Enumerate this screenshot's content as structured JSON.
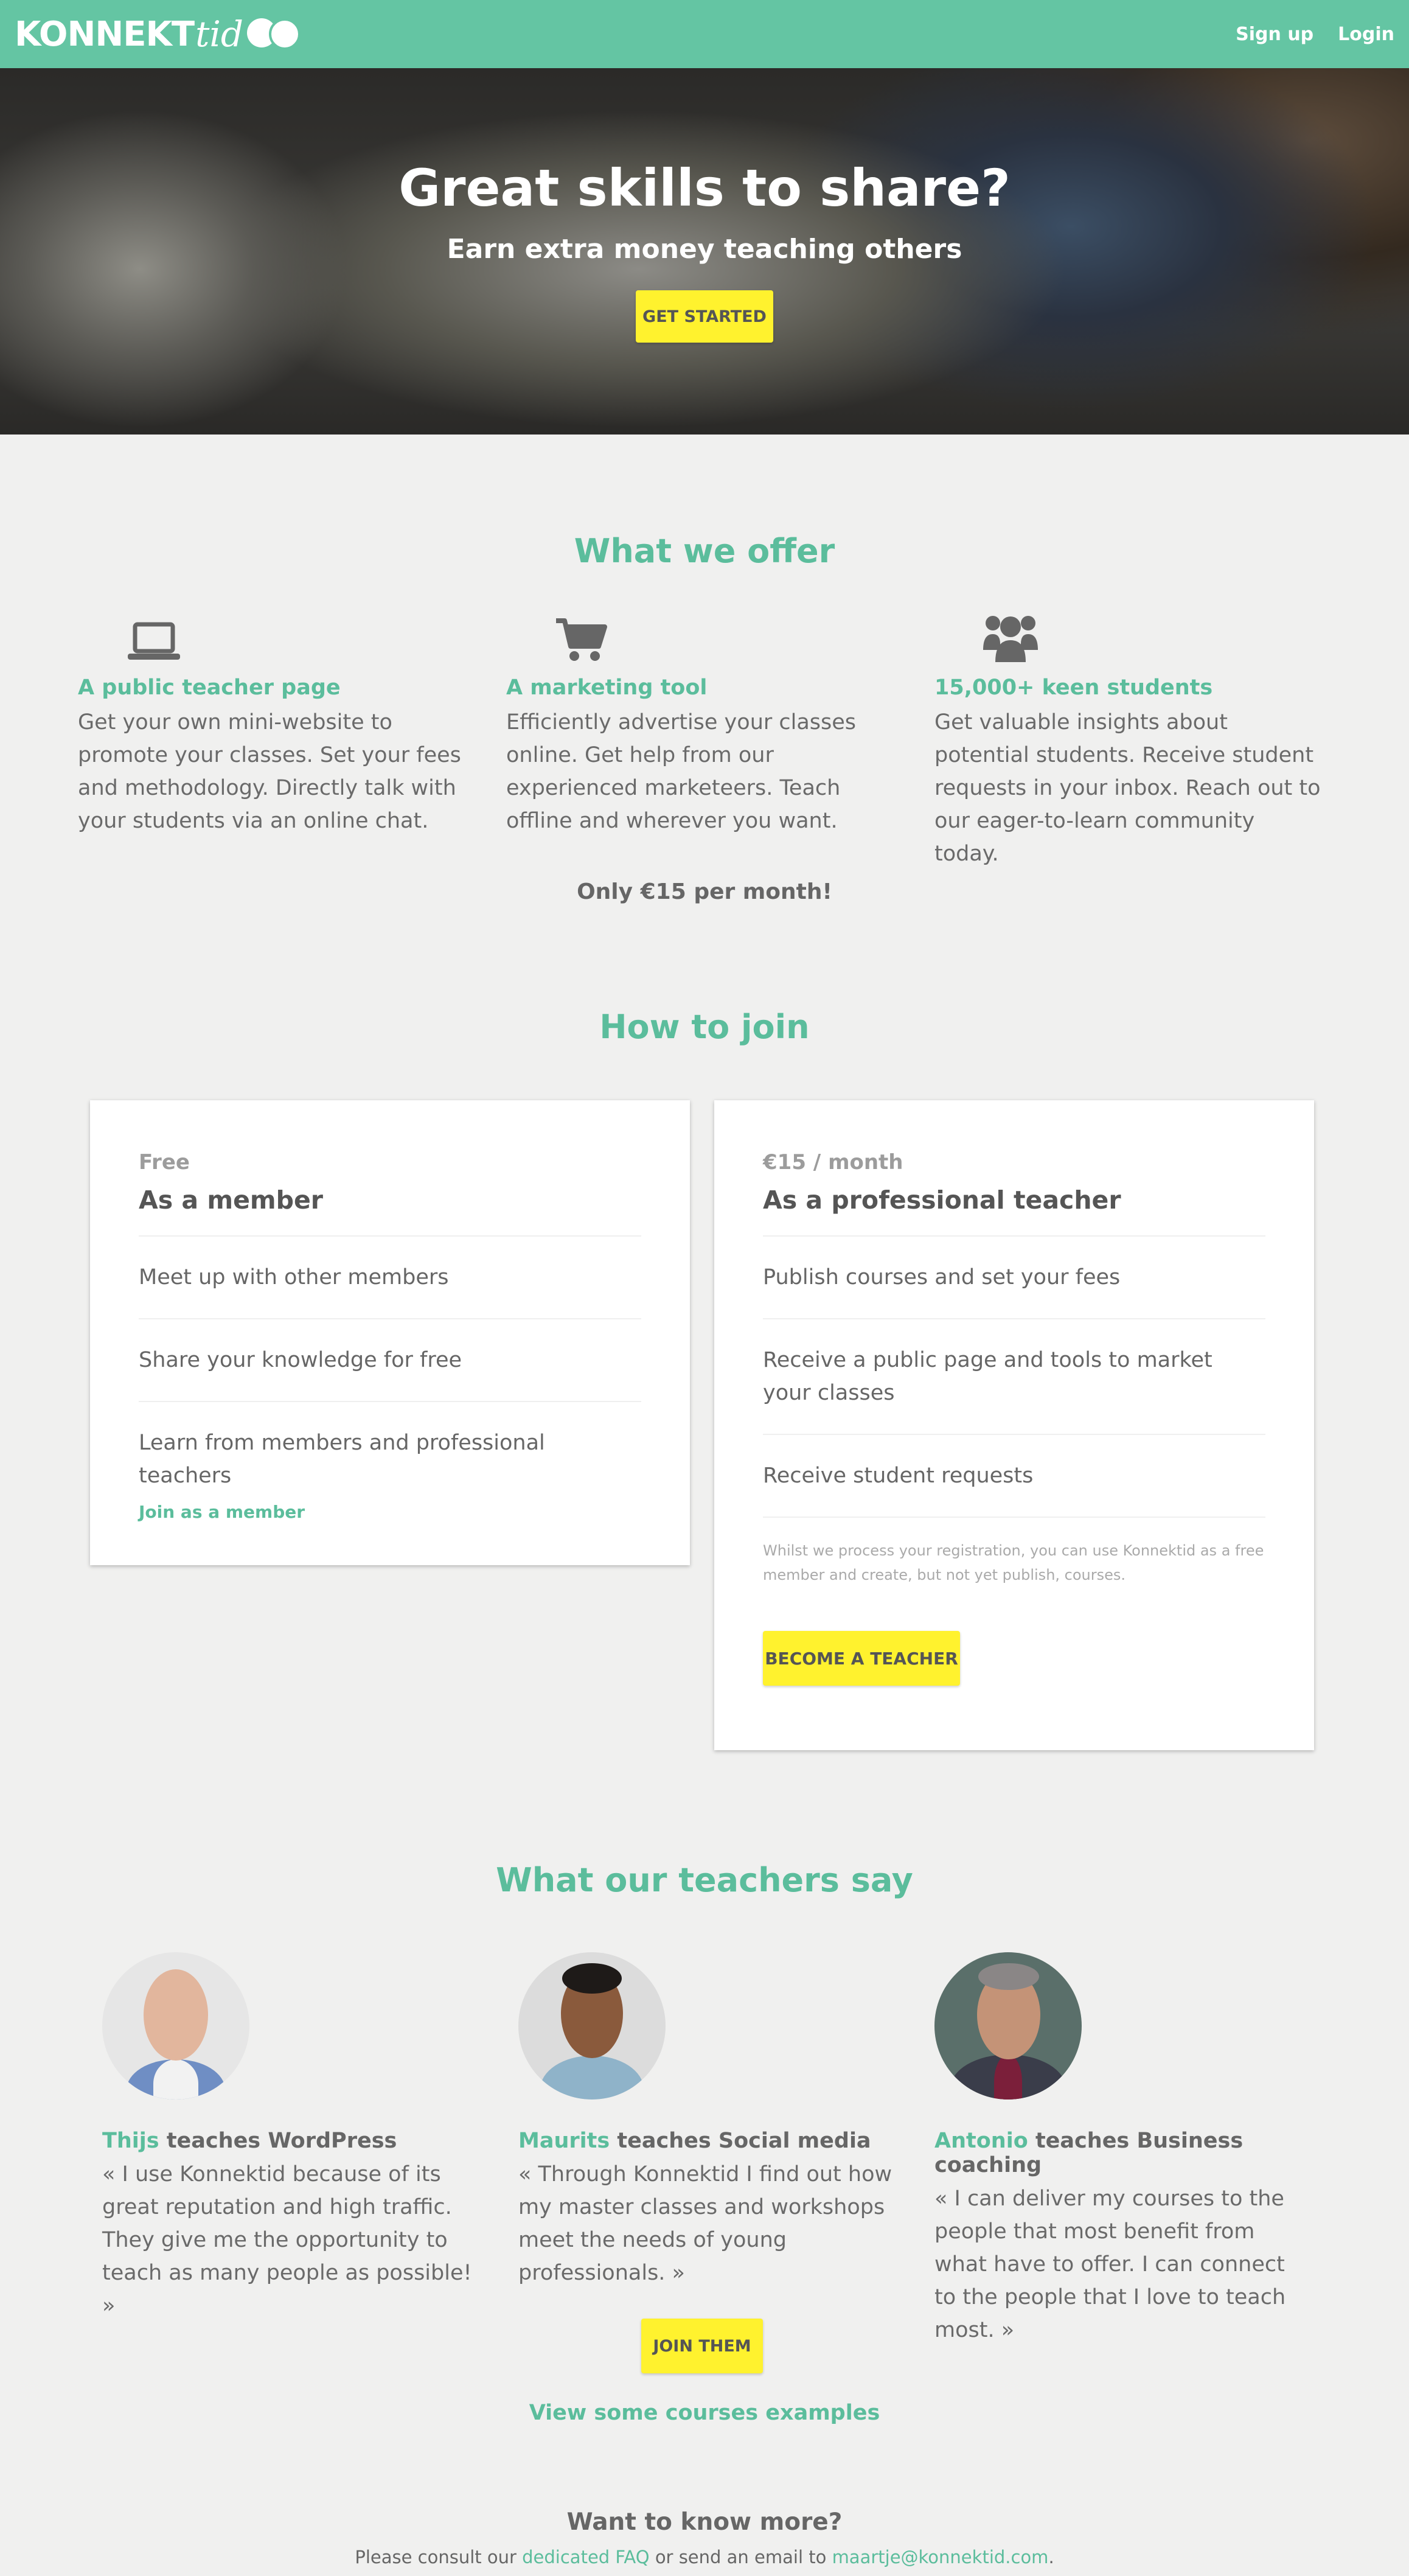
{
  "header": {
    "logo_main": "KONNEKT",
    "logo_script": "tid",
    "nav": {
      "signup": "Sign up",
      "login": "Login"
    },
    "brand_color": "#64c5a3"
  },
  "hero": {
    "title": "Great skills to share?",
    "subtitle": "Earn extra money teaching others",
    "cta": "GET STARTED"
  },
  "offer": {
    "title": "What we offer",
    "items": [
      {
        "icon": "laptop-icon",
        "heading": "A public teacher page",
        "body": "Get your own mini-website to promote your classes. Set your fees and methodology. Directly talk with your students via an online chat."
      },
      {
        "icon": "cart-icon",
        "heading": "A marketing tool",
        "body": "Efficiently advertise your classes online. Get help from our experienced marketeers. Teach offline and wherever you want."
      },
      {
        "icon": "users-icon",
        "heading": "15,000+ keen students",
        "body": "Get valuable insights about potential students. Receive student requests in your inbox. Reach out to our eager-to-learn community today."
      }
    ],
    "price_line": "Only €15 per month!"
  },
  "join": {
    "title": "How to join",
    "member": {
      "price": "Free",
      "plan": "As a member",
      "features": [
        "Meet up with other members",
        "Share your knowledge for free",
        "Learn from members and professional teachers"
      ],
      "link": "Join as a member"
    },
    "teacher": {
      "price": "€15 / month",
      "plan": "As a professional teacher",
      "features": [
        "Publish courses and set your fees",
        "Receive a public page and tools to market your classes",
        "Receive student requests"
      ],
      "note": "Whilst we process your registration, you can use Konnektid as a free member and create, but not yet publish, courses.",
      "cta": "BECOME A TEACHER"
    }
  },
  "testimonials": {
    "title": "What our teachers say",
    "items": [
      {
        "name": "Thijs",
        "topic": "teaches WordPress",
        "quote": "« I use Konnektid because of its great reputation and high traffic. They give me the opportunity to teach as many people as possible! »"
      },
      {
        "name": "Maurits",
        "topic": "teaches Social media",
        "quote": "« Through Konnektid I find out how my master classes and workshops meet the needs of young professionals. »"
      },
      {
        "name": "Antonio",
        "topic": "teaches Business coaching",
        "quote": "« I can deliver my courses to the people that most benefit from what have to offer. I can connect to the people that I love to teach most. »"
      }
    ],
    "cta": "JOIN THEM",
    "view_courses": "View some courses examples"
  },
  "more": {
    "title": "Want to know more?",
    "prefix": "Please consult our",
    "faq_link": "dedicated FAQ",
    "middle": "or send an email to",
    "email": "maartje@konnektid.com",
    "suffix": "."
  }
}
